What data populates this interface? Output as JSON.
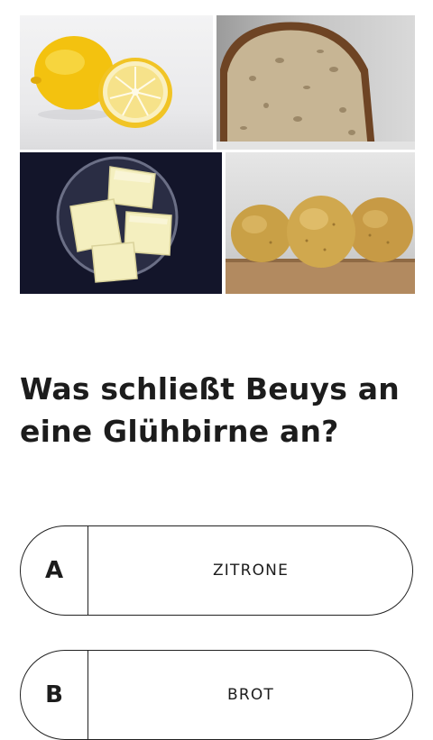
{
  "images": [
    {
      "id": "lemon",
      "icon": "lemon-image"
    },
    {
      "id": "bread",
      "icon": "bread-image"
    },
    {
      "id": "butter",
      "icon": "butter-image"
    },
    {
      "id": "potato",
      "icon": "potato-image"
    }
  ],
  "quiz": {
    "question": "Was schließt Beuys an eine Glühbirne an?",
    "answers": [
      {
        "letter": "A",
        "label": "ZITRONE"
      },
      {
        "letter": "B",
        "label": "BROT"
      }
    ]
  }
}
